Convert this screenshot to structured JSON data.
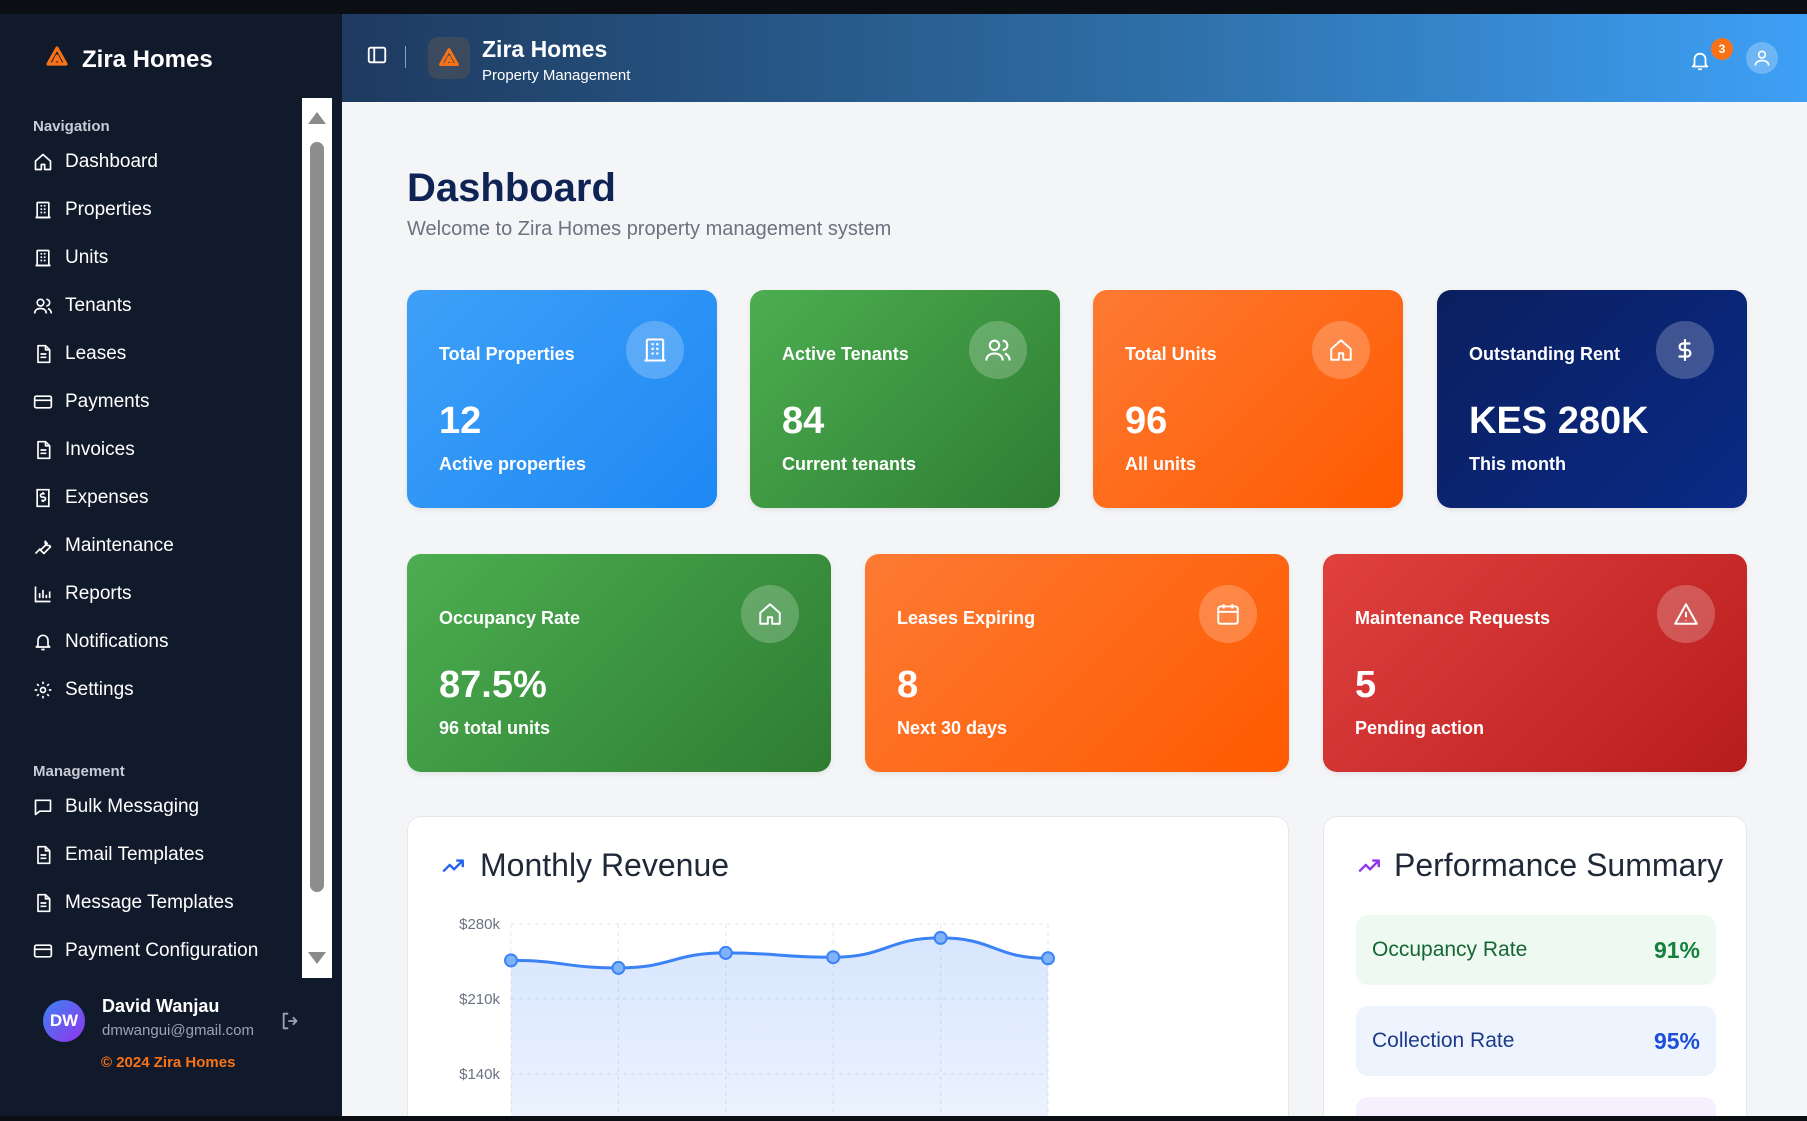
{
  "brand": {
    "name": "Zira Homes"
  },
  "sidebar": {
    "navigation_title": "Navigation",
    "items": [
      {
        "label": "Dashboard",
        "icon": "home-icon"
      },
      {
        "label": "Properties",
        "icon": "building-icon"
      },
      {
        "label": "Units",
        "icon": "building-icon"
      },
      {
        "label": "Tenants",
        "icon": "users-icon"
      },
      {
        "label": "Leases",
        "icon": "document-icon"
      },
      {
        "label": "Payments",
        "icon": "credit-card-icon"
      },
      {
        "label": "Invoices",
        "icon": "document-icon"
      },
      {
        "label": "Expenses",
        "icon": "receipt-icon"
      },
      {
        "label": "Maintenance",
        "icon": "wrench-icon"
      },
      {
        "label": "Reports",
        "icon": "bar-chart-icon"
      },
      {
        "label": "Notifications",
        "icon": "bell-icon"
      },
      {
        "label": "Settings",
        "icon": "gear-icon"
      }
    ],
    "management_title": "Management",
    "management_items": [
      {
        "label": "Bulk Messaging",
        "icon": "message-icon"
      },
      {
        "label": "Email Templates",
        "icon": "document-icon"
      },
      {
        "label": "Message Templates",
        "icon": "document-icon"
      },
      {
        "label": "Payment Configuration",
        "icon": "credit-card-icon"
      }
    ]
  },
  "user": {
    "initials": "DW",
    "name": "David Wanjau",
    "email": "dmwangui@gmail.com",
    "copyright": "© 2024 Zira Homes"
  },
  "topbar": {
    "title": "Zira Homes",
    "subtitle": "Property Management",
    "notification_count": "3"
  },
  "page": {
    "title": "Dashboard",
    "subtitle": "Welcome to Zira Homes property management system"
  },
  "stats_row1": [
    {
      "label": "Total Properties",
      "value": "12",
      "sub": "Active properties",
      "icon": "building-icon",
      "color": "#2f8cf6"
    },
    {
      "label": "Active Tenants",
      "value": "84",
      "sub": "Current tenants",
      "icon": "users-icon",
      "color": "#3f9f47"
    },
    {
      "label": "Total Units",
      "value": "96",
      "sub": "All units",
      "icon": "home-icon",
      "color": "#fb6a1e"
    },
    {
      "label": "Outstanding Rent",
      "value": "KES 280K",
      "sub": "This month",
      "icon": "dollar-icon",
      "color": "#0b1f5e"
    }
  ],
  "stats_row2": [
    {
      "label": "Occupancy Rate",
      "value": "87.5%",
      "sub": "96 total units",
      "icon": "home-icon",
      "color": "#3f9f47"
    },
    {
      "label": "Leases Expiring",
      "value": "8",
      "sub": "Next 30 days",
      "icon": "calendar-icon",
      "color": "#fb6a1e"
    },
    {
      "label": "Maintenance Requests",
      "value": "5",
      "sub": "Pending action",
      "icon": "warning-icon",
      "color": "#d32f2f"
    }
  ],
  "revenue": {
    "title": "Monthly Revenue",
    "chart_data": {
      "type": "area",
      "title": "Monthly Revenue",
      "y_ticks": [
        "$280k",
        "$210k",
        "$140k"
      ],
      "ylim": [
        140000,
        280000
      ],
      "values": [
        246000,
        239000,
        253000,
        249000,
        267000,
        248000
      ]
    }
  },
  "performance": {
    "title": "Performance Summary",
    "rows": [
      {
        "label": "Occupancy Rate",
        "value": "91%",
        "bg": "#eefaf1",
        "color": "#15803d"
      },
      {
        "label": "Collection Rate",
        "value": "95%",
        "bg": "#eef4fe",
        "color": "#1d4ed8"
      }
    ]
  }
}
